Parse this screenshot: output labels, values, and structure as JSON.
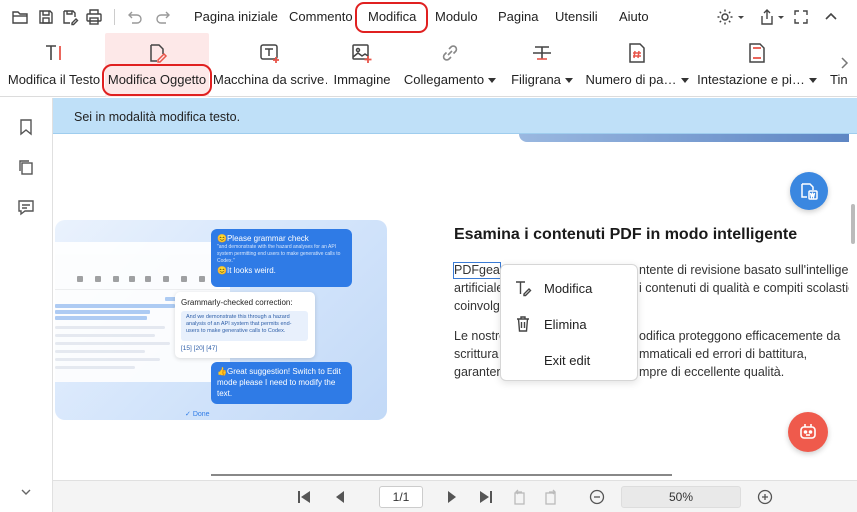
{
  "menubar": {
    "items": [
      "Pagina iniziale",
      "Commento",
      "Modifica",
      "Modulo",
      "Pagina",
      "Utensili",
      "Aiuto"
    ],
    "active": "Modifica"
  },
  "ribbon": {
    "items": [
      {
        "label": "Modifica il Testo",
        "icon": "edit-text-icon"
      },
      {
        "label": "Modifica Oggetto",
        "icon": "edit-object-icon"
      },
      {
        "label": "Macchina da scrive…",
        "icon": "typewriter-icon"
      },
      {
        "label": "Immagine",
        "icon": "image-add-icon"
      },
      {
        "label": "Collegamento",
        "icon": "link-icon"
      },
      {
        "label": "Filigrana",
        "icon": "watermark-icon"
      },
      {
        "label": "Numero di pa…",
        "icon": "page-number-icon"
      },
      {
        "label": "Intestazione e pi…",
        "icon": "header-footer-icon"
      },
      {
        "label": "Tin",
        "icon": "background-icon"
      }
    ],
    "active": "Modifica Oggetto"
  },
  "notice": {
    "text": "Sei in modalità modifica testo."
  },
  "document": {
    "heading": "Esamina i contenuti PDF in modo intelligente",
    "p1_lines": [
      "PDFgear",
      "ntente di revisione basato sull'intelligenza",
      "artificiale",
      "i contenuti di qualità e compiti scolastici",
      "coinvolg"
    ],
    "p2_lines": [
      "Le nostre",
      "odifica proteggono efficacemente da",
      "scrittura",
      "mmaticali ed errori di battitura,",
      "garanten",
      "mpre di eccellente qualità."
    ],
    "promo": {
      "bubble1_title": "Please grammar check",
      "bubble1_text": "\"and demonstrate with the hazard analyses for an API system permitting end users to make generative calls to Codex.\"",
      "bubble1_reply": "It looks weird.",
      "card_title": "Grammarly-checked correction:",
      "card_text": "And we demonstrate this through a hazard analysis of an API system that permits end-users to make generative calls to Codex.",
      "card_refs": "[15] [20] [47]",
      "bubble2_text": "Great suggestion! Switch to Edit mode please I need to modify the text.",
      "done": "Done"
    }
  },
  "context_menu": {
    "items": [
      {
        "label": "Modifica",
        "icon": "edit-text-icon"
      },
      {
        "label": "Elimina",
        "icon": "trash-icon"
      },
      {
        "label": "Exit edit",
        "icon": ""
      }
    ]
  },
  "bottombar": {
    "page_indicator": "1/1",
    "zoom": "50%"
  },
  "colors": {
    "accent_red": "#e02020",
    "notice_bg": "#bfe0f8",
    "fab_blue": "#3a87e0",
    "fab_red": "#ef5a4c"
  }
}
